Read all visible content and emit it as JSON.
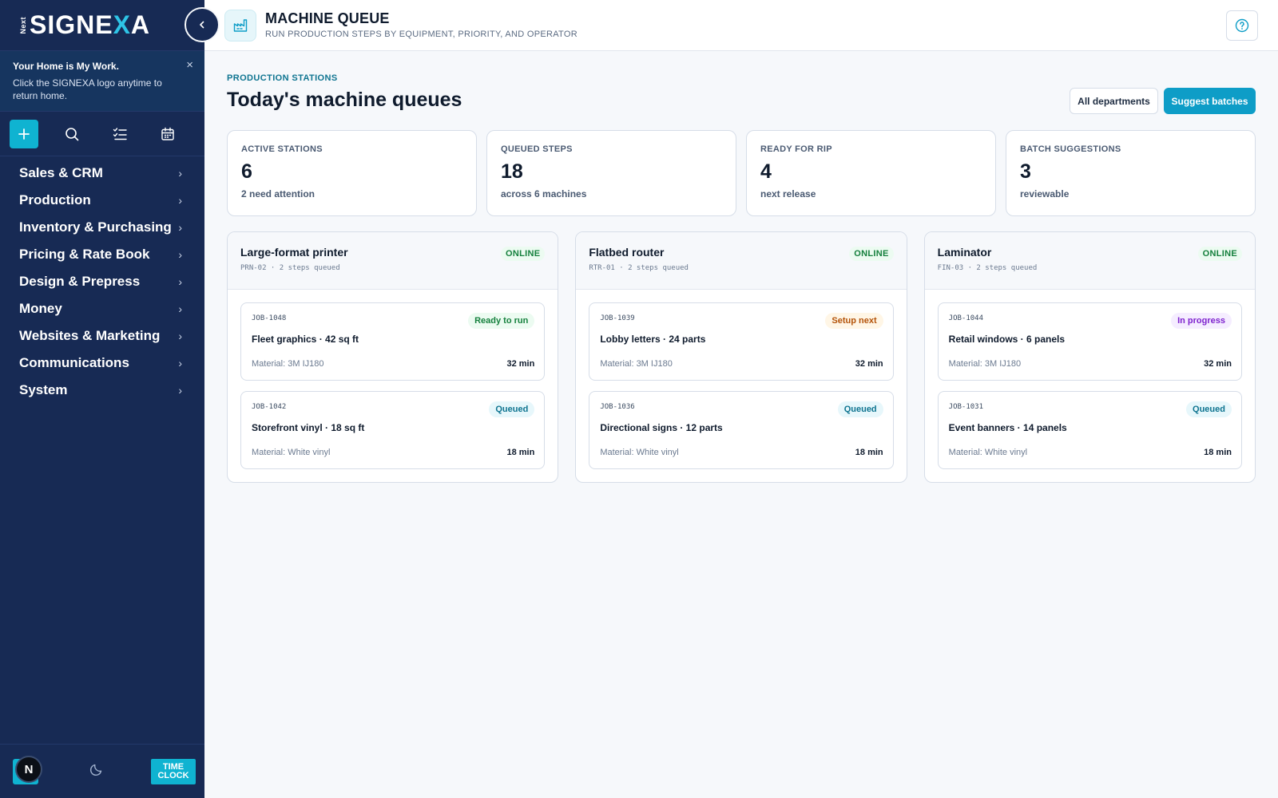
{
  "brand": {
    "prefix": "Next",
    "name_main": "SIGNE",
    "name_x": "X",
    "name_end": "A"
  },
  "tip": {
    "title": "Your Home is My Work.",
    "body": "Click the SIGNEXA logo anytime to return home.",
    "close": "×"
  },
  "tools": [
    {
      "icon": "plus-icon"
    },
    {
      "icon": "search-icon"
    },
    {
      "icon": "checklist-icon"
    },
    {
      "icon": "calendar-icon"
    }
  ],
  "nav": [
    {
      "label": "Sales & CRM"
    },
    {
      "label": "Production"
    },
    {
      "label": "Inventory & Purchasing"
    },
    {
      "label": "Pricing & Rate Book"
    },
    {
      "label": "Design & Prepress"
    },
    {
      "label": "Money"
    },
    {
      "label": "Websites & Marketing"
    },
    {
      "label": "Communications"
    },
    {
      "label": "System"
    }
  ],
  "footer": {
    "avatar_initial": "N",
    "timeclock_line1": "TIME",
    "timeclock_line2": "CLOCK"
  },
  "header": {
    "title": "MACHINE QUEUE",
    "subtitle": "RUN PRODUCTION STEPS BY EQUIPMENT, PRIORITY, AND OPERATOR"
  },
  "main": {
    "eyebrow": "PRODUCTION STATIONS",
    "title": "Today's machine queues",
    "departments_button": "All departments",
    "suggest_button": "Suggest batches"
  },
  "stats": [
    {
      "label": "ACTIVE STATIONS",
      "value": "6",
      "note": "2 need attention"
    },
    {
      "label": "QUEUED STEPS",
      "value": "18",
      "note": "across 6 machines"
    },
    {
      "label": "READY FOR RIP",
      "value": "4",
      "note": "next release"
    },
    {
      "label": "BATCH SUGGESTIONS",
      "value": "3",
      "note": "reviewable"
    }
  ],
  "machines": [
    {
      "name": "Large-format printer",
      "meta": "PRN-02 · 2 steps queued",
      "status": "ONLINE",
      "jobs": [
        {
          "id": "JOB-1048",
          "badge": "Ready to run",
          "title": "Fleet graphics · 42 sq ft",
          "material": "Material: 3M IJ180",
          "time": "32 min"
        },
        {
          "id": "JOB-1042",
          "badge": "Queued",
          "title": "Storefront vinyl · 18 sq ft",
          "material": "Material: White vinyl",
          "time": "18 min"
        }
      ]
    },
    {
      "name": "Flatbed router",
      "meta": "RTR-01 · 2 steps queued",
      "status": "ONLINE",
      "jobs": [
        {
          "id": "JOB-1039",
          "badge": "Setup next",
          "title": "Lobby letters · 24 parts",
          "material": "Material: 3M IJ180",
          "time": "32 min"
        },
        {
          "id": "JOB-1036",
          "badge": "Queued",
          "title": "Directional signs · 12 parts",
          "material": "Material: White vinyl",
          "time": "18 min"
        }
      ]
    },
    {
      "name": "Laminator",
      "meta": "FIN-03 · 2 steps queued",
      "status": "ONLINE",
      "jobs": [
        {
          "id": "JOB-1044",
          "badge": "In progress",
          "title": "Retail windows · 6 panels",
          "material": "Material: 3M IJ180",
          "time": "32 min"
        },
        {
          "id": "JOB-1031",
          "badge": "Queued",
          "title": "Event banners · 14 panels",
          "material": "Material: White vinyl",
          "time": "18 min"
        }
      ]
    }
  ]
}
